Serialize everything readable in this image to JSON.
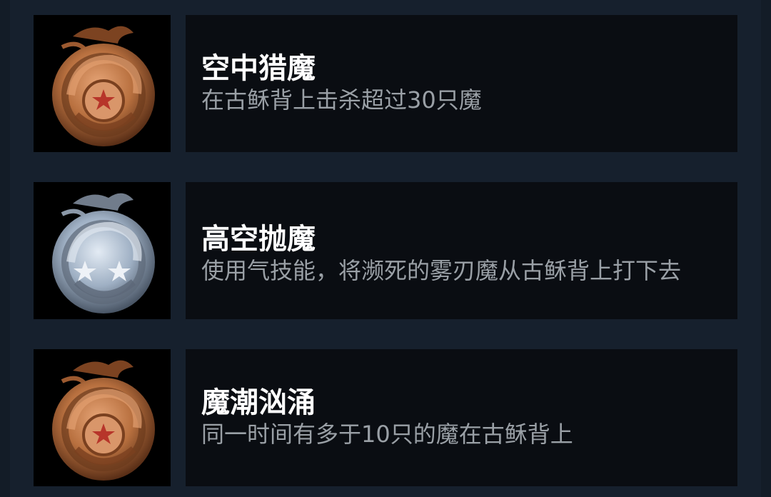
{
  "achievements": [
    {
      "title": "空中猎魔",
      "description": "在古稣背上击杀超过30只魔",
      "badge_icon": "bronze-dragon-badge-icon",
      "badge_color": "#b8703f",
      "stars": 1
    },
    {
      "title": "高空抛魔",
      "description": "使用气技能，将濒死的雾刃魔从古稣背上打下去",
      "badge_icon": "silver-dragon-badge-icon",
      "badge_color": "#9fb0c4",
      "stars": 2
    },
    {
      "title": "魔潮汹涌",
      "description": "同一时间有多于10只的魔在古稣背上",
      "badge_icon": "bronze-dragon-badge-icon",
      "badge_color": "#b8703f",
      "stars": 1
    }
  ],
  "colors": {
    "background": "#16202d",
    "panel": "#0a0d12",
    "title_text": "#ffffff",
    "description_text": "#9aa0a6"
  }
}
